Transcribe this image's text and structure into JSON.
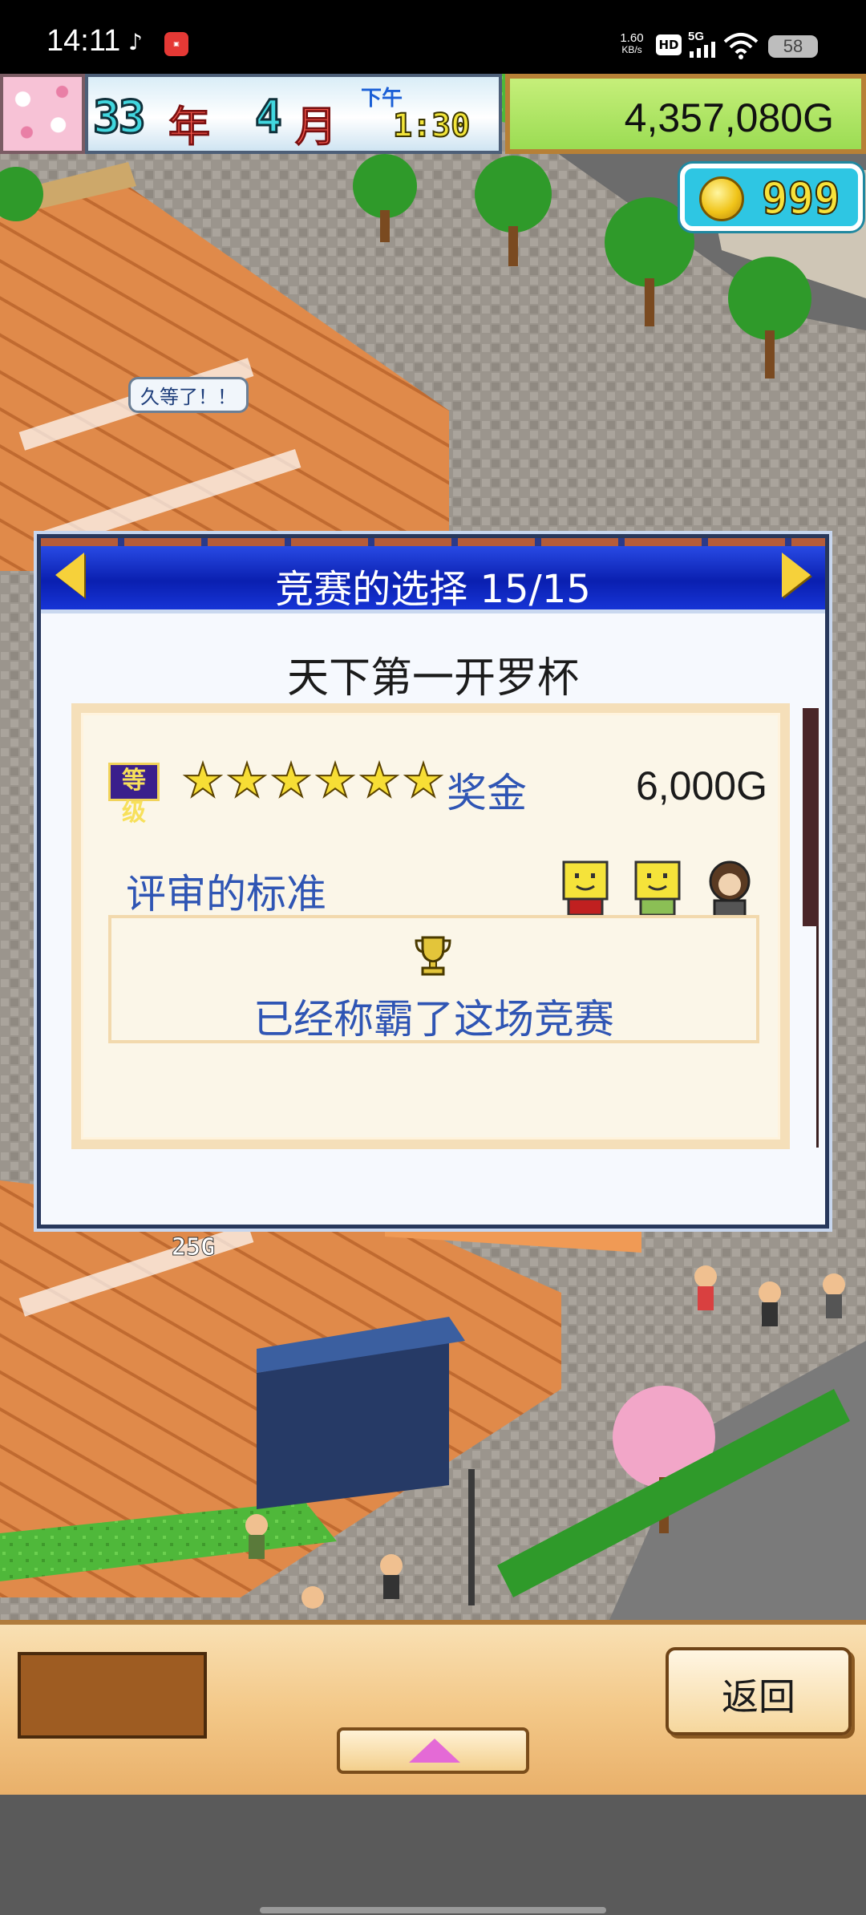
{
  "status_bar": {
    "time": "14:11",
    "net_rate_value": "1.60",
    "net_rate_unit": "KB/s",
    "hd": "HD",
    "signal": "5G",
    "battery": "58"
  },
  "hud": {
    "year_num": "33",
    "year_unit": "年",
    "month_num": "4",
    "month_unit": "月",
    "ampm": "下午",
    "clock": "1:30",
    "money": "4,357,080G",
    "coins": "999"
  },
  "scene": {
    "speech_bubble": "久等了！！",
    "price_tag": "25G"
  },
  "dialog": {
    "title": "竞赛的选择 15/15",
    "contest_name": "天下第一开罗杯",
    "rank_label": "等级",
    "stars": 6,
    "prize_label": "奖金",
    "prize_value": "6,000G",
    "criteria_label": "评审的标准",
    "result_text": "已经称霸了这场竞赛"
  },
  "bottom_bar": {
    "back_label": "返回"
  },
  "colors": {
    "accent_blue": "#2f55b4",
    "header_blue": "#1634d6",
    "gold": "#f7de35"
  },
  "icons": [
    "tiktok-icon",
    "app-icon",
    "wifi-icon",
    "coin-icon",
    "trophy-icon",
    "star-icon",
    "arrow-left-icon",
    "arrow-right-icon",
    "up-arrow-icon"
  ]
}
